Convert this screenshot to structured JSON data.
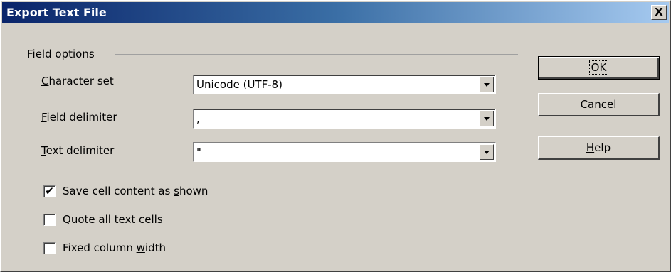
{
  "window": {
    "title": "Export Text File",
    "close_label": "X"
  },
  "field_options": {
    "group_label": "Field options",
    "character_set": {
      "label_mnemonic": "C",
      "label_rest": "haracter set",
      "value": "Unicode (UTF-8)"
    },
    "field_delimiter": {
      "label_mnemonic": "F",
      "label_rest": "ield delimiter",
      "value": ","
    },
    "text_delimiter": {
      "label_mnemonic": "T",
      "label_rest": "ext delimiter",
      "value": "\""
    }
  },
  "checkboxes": [
    {
      "label_pre": "Save cell content as ",
      "mnemonic": "s",
      "label_post": "hown",
      "checked": true,
      "mark": "✔"
    },
    {
      "label_pre": "",
      "mnemonic": "Q",
      "label_post": "uote all text cells",
      "checked": false,
      "mark": ""
    },
    {
      "label_pre": "Fixed column ",
      "mnemonic": "w",
      "label_post": "idth",
      "checked": false,
      "mark": ""
    }
  ],
  "buttons": {
    "ok": "OK",
    "cancel": "Cancel",
    "help_mnemonic": "H",
    "help_rest": "elp"
  }
}
